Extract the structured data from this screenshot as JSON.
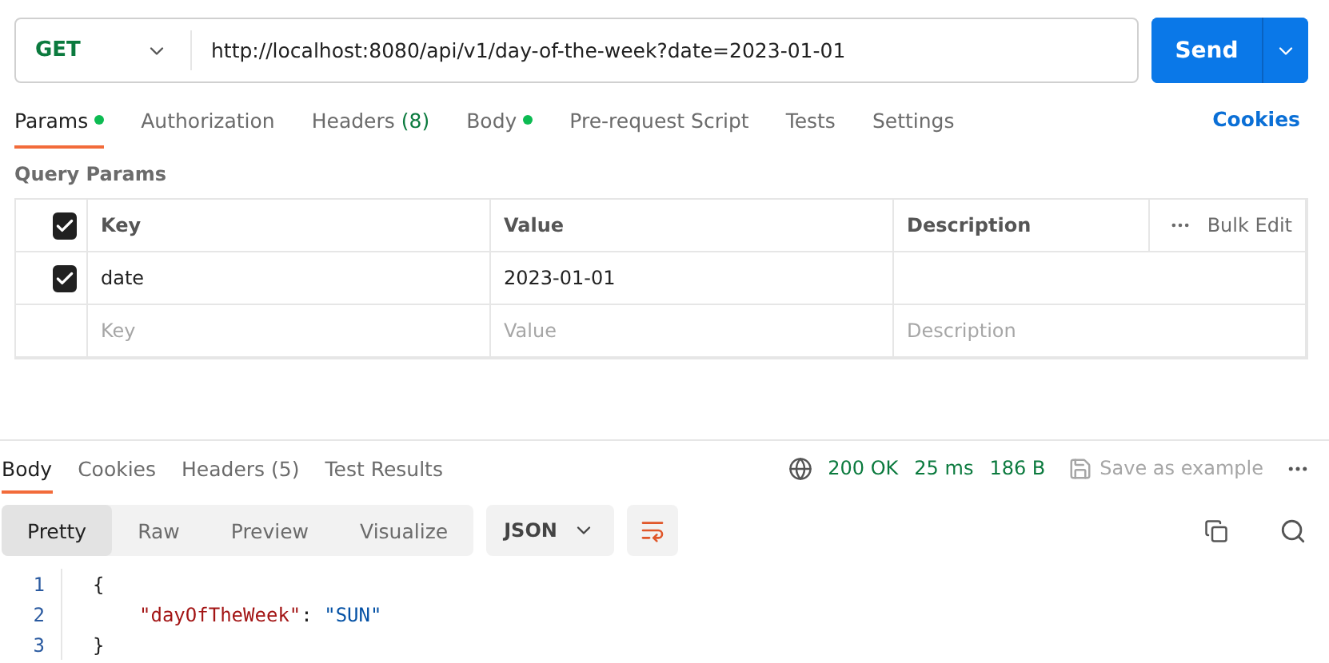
{
  "request": {
    "method": "GET",
    "url": "http://localhost:8080/api/v1/day-of-the-week?date=2023-01-01",
    "send": "Send"
  },
  "request_tabs": [
    {
      "label": "Params",
      "dot": true,
      "selected": true
    },
    {
      "label": "Authorization",
      "dot": false,
      "selected": false
    },
    {
      "label": "Headers",
      "count": "(8)",
      "dot": false,
      "selected": false
    },
    {
      "label": "Body",
      "dot": true,
      "selected": false
    },
    {
      "label": "Pre-request Script",
      "dot": false,
      "selected": false
    },
    {
      "label": "Tests",
      "dot": false,
      "selected": false
    },
    {
      "label": "Settings",
      "dot": false,
      "selected": false
    }
  ],
  "cookies_link": "Cookies",
  "query_params": {
    "title": "Query Params",
    "columns": [
      "Key",
      "Value",
      "Description"
    ],
    "all_checked": true,
    "bulk_edit": "Bulk Edit",
    "rows": [
      {
        "checked": true,
        "key": "date",
        "value": "2023-01-01",
        "description": ""
      }
    ],
    "placeholders": {
      "key": "Key",
      "value": "Value",
      "description": "Description"
    }
  },
  "response_tabs": [
    {
      "label": "Body",
      "selected": true
    },
    {
      "label": "Cookies",
      "selected": false
    },
    {
      "label": "Headers",
      "count": "(5)",
      "selected": false
    },
    {
      "label": "Test Results",
      "selected": false
    }
  ],
  "status": {
    "code": "200 OK",
    "time": "25 ms",
    "size": "186 B",
    "save": "Save as example"
  },
  "view_modes": [
    {
      "label": "Pretty",
      "selected": true
    },
    {
      "label": "Raw",
      "selected": false
    },
    {
      "label": "Preview",
      "selected": false
    },
    {
      "label": "Visualize",
      "selected": false
    }
  ],
  "format": "JSON",
  "code_lines": [
    {
      "number": "1",
      "kind": "brace",
      "tokens": [
        {
          "kind": "punct",
          "text": "{"
        }
      ]
    },
    {
      "number": "2",
      "kind": "member",
      "tokens": [
        {
          "kind": "key",
          "text": "\"dayOfTheWeek\""
        },
        {
          "kind": "punct",
          "text": ": "
        },
        {
          "kind": "string",
          "text": "\"SUN\""
        }
      ]
    },
    {
      "number": "3",
      "kind": "brace",
      "tokens": [
        {
          "kind": "punct",
          "text": "}"
        }
      ]
    }
  ]
}
